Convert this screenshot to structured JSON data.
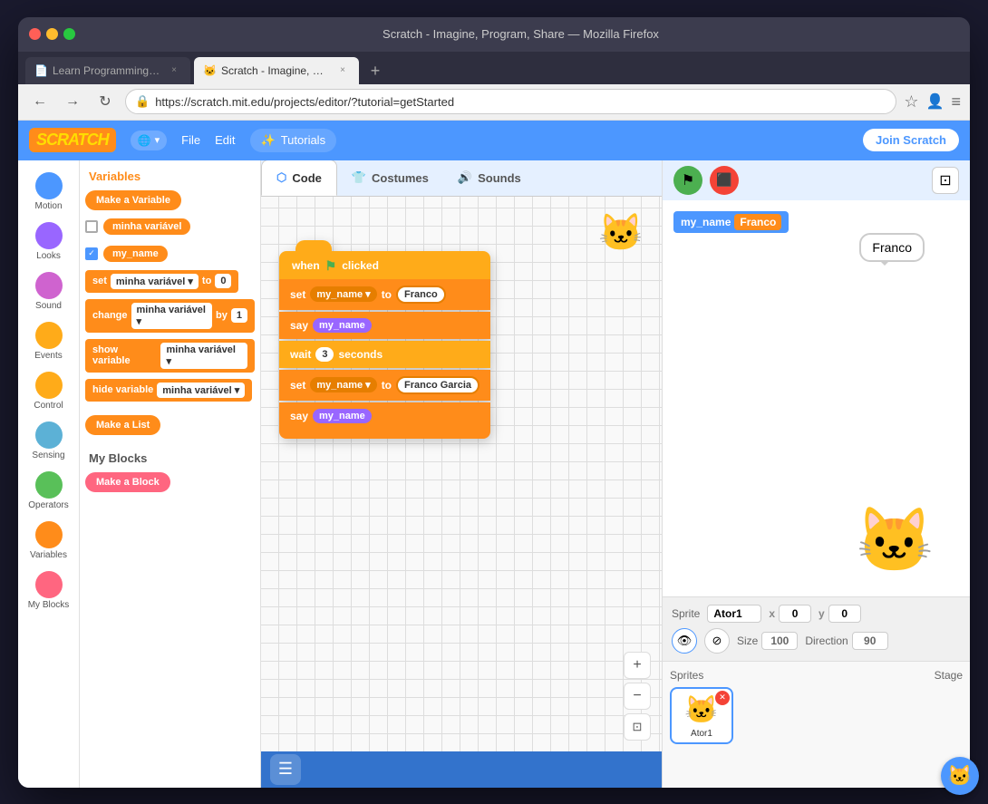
{
  "window": {
    "title": "Scratch - Imagine, Program, Share — Mozilla Firefox",
    "controls": {
      "close": "×",
      "minimize": "−",
      "maximize": "□"
    }
  },
  "browser": {
    "tabs": [
      {
        "id": "tab1",
        "label": "Learn Programming: Data Typ…",
        "favicon": "📄",
        "active": false
      },
      {
        "id": "tab2",
        "label": "Scratch - Imagine, Program, S…",
        "favicon": "🐱",
        "active": true
      }
    ],
    "new_tab": "+",
    "nav": {
      "back": "←",
      "forward": "→",
      "refresh": "↻"
    },
    "address_bar": {
      "url": "https://scratch.mit.edu/projects/editor/?tutorial=getStarted",
      "lock_icon": "🔒"
    },
    "bookmark_icon": "☆",
    "menu_icon": "≡"
  },
  "scratch": {
    "logo_text": "SCRATCH",
    "header": {
      "globe_label": "🌐",
      "file_label": "File",
      "edit_label": "Edit",
      "tutorials_label": "✨ Tutorials",
      "join_label": "Join Scratch"
    },
    "tabs": {
      "code_label": "Code",
      "costumes_label": "Costumes",
      "sounds_label": "Sounds"
    },
    "categories": [
      {
        "id": "motion",
        "label": "Motion",
        "color": "#4c97ff"
      },
      {
        "id": "looks",
        "label": "Looks",
        "color": "#9966ff"
      },
      {
        "id": "sound",
        "label": "Sound",
        "color": "#cf63cf"
      },
      {
        "id": "events",
        "label": "Events",
        "color": "#ffab19"
      },
      {
        "id": "control",
        "label": "Control",
        "color": "#ffab19"
      },
      {
        "id": "sensing",
        "label": "Sensing",
        "color": "#5cb1d6"
      },
      {
        "id": "operators",
        "label": "Operators",
        "color": "#59c059"
      },
      {
        "id": "variables",
        "label": "Variables",
        "color": "#ff8c1a"
      },
      {
        "id": "myblocks",
        "label": "My Blocks",
        "color": "#ff6680"
      }
    ],
    "blocks_panel": {
      "section_variables": "Variables",
      "make_variable_btn": "Make a Variable",
      "var1_name": "minha variável",
      "var1_checked": false,
      "var2_name": "my_name",
      "var2_checked": true,
      "set_label": "set",
      "var_dropdown1": "minha variável ▾",
      "to_label": "to",
      "set_val": "0",
      "change_label": "change",
      "var_dropdown2": "minha variável ▾",
      "by_label": "by",
      "change_val": "1",
      "show_label": "show variable",
      "var_dropdown3": "minha variável ▾",
      "hide_label": "hide variable",
      "var_dropdown4": "minha variável ▾",
      "make_list_btn": "Make a List",
      "section_myblocks": "My Blocks",
      "make_block_btn": "Make a Block"
    },
    "workspace": {
      "cat_emoji": "🐱",
      "hat_block": "when 🏳️ clicked",
      "blocks": [
        {
          "type": "set",
          "var": "my_name ▾",
          "to": "Franco"
        },
        {
          "type": "say",
          "var": "my_name"
        },
        {
          "type": "wait",
          "seconds": "3",
          "label": "seconds"
        },
        {
          "type": "set",
          "var": "my_name ▾",
          "to": "Franco Garcia"
        },
        {
          "type": "say",
          "var": "my_name"
        }
      ]
    },
    "stage": {
      "my_name_label": "my_name",
      "my_name_value": "Franco",
      "speech_text": "Franco",
      "cat_emoji": "🐱",
      "sprite_name": "Ator1",
      "sprite_x": "0",
      "sprite_y": "0",
      "sprite_size": "100",
      "sprite_direction": "90",
      "show_label": "👁",
      "hide_label": "⊘",
      "size_label": "Size",
      "direction_label": "Direction",
      "sprite_label": "Sprite"
    },
    "sprites_list": [
      {
        "id": "ator1",
        "name": "Ator1",
        "emoji": "🐱",
        "selected": true
      }
    ],
    "add_sprite_btn": "🐱",
    "zoom": {
      "in": "+",
      "out": "−",
      "reset": "⊡"
    },
    "bottom_bar": {
      "extensions_icon": "☰"
    }
  }
}
